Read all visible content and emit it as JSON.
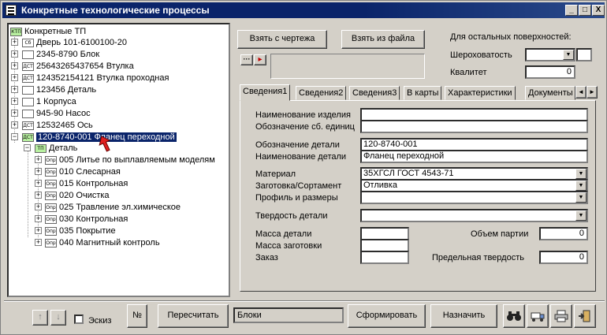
{
  "window": {
    "title": "Конкретные технологические процессы",
    "controls": [
      "_",
      "□",
      "X"
    ]
  },
  "tree": {
    "root": {
      "icon": "КТП",
      "label": "Конкретные ТП"
    },
    "items": [
      {
        "icon": "Сб",
        "label": "Дверь 101-6100100-20",
        "expander": "+"
      },
      {
        "icon": "",
        "label": "2345-8790 Блок",
        "expander": "+"
      },
      {
        "icon": "ДСТ",
        "label": "25643265437654 Втулка",
        "expander": "+"
      },
      {
        "icon": "ДСТ",
        "label": "124352154121 Втулка проходная",
        "expander": "+"
      },
      {
        "icon": "",
        "label": "123456 Деталь",
        "expander": "+"
      },
      {
        "icon": "",
        "label": "1 Корпуса",
        "expander": "+"
      },
      {
        "icon": "",
        "label": "945-90 Насос",
        "expander": "+"
      },
      {
        "icon": "ДСТ",
        "label": "12532465 Ось",
        "expander": "+"
      },
      {
        "icon": "ДСТ",
        "label": "120-8740-001 Фланец переходной",
        "expander": "−",
        "selected": true
      }
    ],
    "child": {
      "icon": "ТП",
      "label": "Деталь",
      "expander": "−"
    },
    "operations": [
      {
        "icon": "Опр",
        "label": "005 Литье по выплавляемым моделям"
      },
      {
        "icon": "Опр",
        "label": "010 Слесарная"
      },
      {
        "icon": "Опр",
        "label": "015 Контрольная"
      },
      {
        "icon": "Опр",
        "label": "020 Очистка"
      },
      {
        "icon": "Опр",
        "label": "025 Травление эл.химическое"
      },
      {
        "icon": "Опр",
        "label": "030 Контрольная"
      },
      {
        "icon": "Опр",
        "label": "035 Покрытие"
      },
      {
        "icon": "Опр",
        "label": "040 Магнитный контроль"
      }
    ]
  },
  "toolbar": {
    "from_drawing": "Взять с чертежа",
    "from_file": "Взять из файла",
    "small_btn1": "···",
    "small_btn2": "▸"
  },
  "surfaces": {
    "header": "Для остальных поверхностей:",
    "roughness_label": "Шероховатость",
    "roughness_value": "",
    "quality_label": "Квалитет",
    "quality_value": "0"
  },
  "tabs": [
    "Сведения1",
    "Сведения2",
    "Сведения3",
    "В карты",
    "Характеристики",
    "Документы"
  ],
  "form": {
    "product_name_label": "Наименование изделия",
    "product_name": "",
    "assembly_label": "Обозначение сб. единиц",
    "assembly": "",
    "detail_code_label": "Обозначение детали",
    "detail_code": "120-8740-001",
    "detail_name_label": "Наименование детали",
    "detail_name": "Фланец переходной",
    "material_label": "Материал",
    "material": "35ХГСЛ ГОСТ 4543-71",
    "blank_label": "Заготовка/Сортамент",
    "blank": "Отливка",
    "profile_label": "Профиль и размеры",
    "profile": "",
    "hardness_label": "Твердость детали",
    "hardness": "",
    "mass_detail_label": "Масса детали",
    "mass_detail": "",
    "mass_blank_label": "Масса заготовки",
    "mass_blank": "",
    "order_label": "Заказ",
    "order": "",
    "batch_label": "Объем партии",
    "batch": "0",
    "max_hardness_label": "Предельная твердость",
    "max_hardness": "0"
  },
  "bottom": {
    "up": "↑",
    "down": "↓",
    "sketch_label": "Эскиз",
    "num_btn": "№",
    "recalc": "Пересчитать",
    "blocks": "Блоки",
    "generate": "Сформировать",
    "assign": "Назначить"
  }
}
